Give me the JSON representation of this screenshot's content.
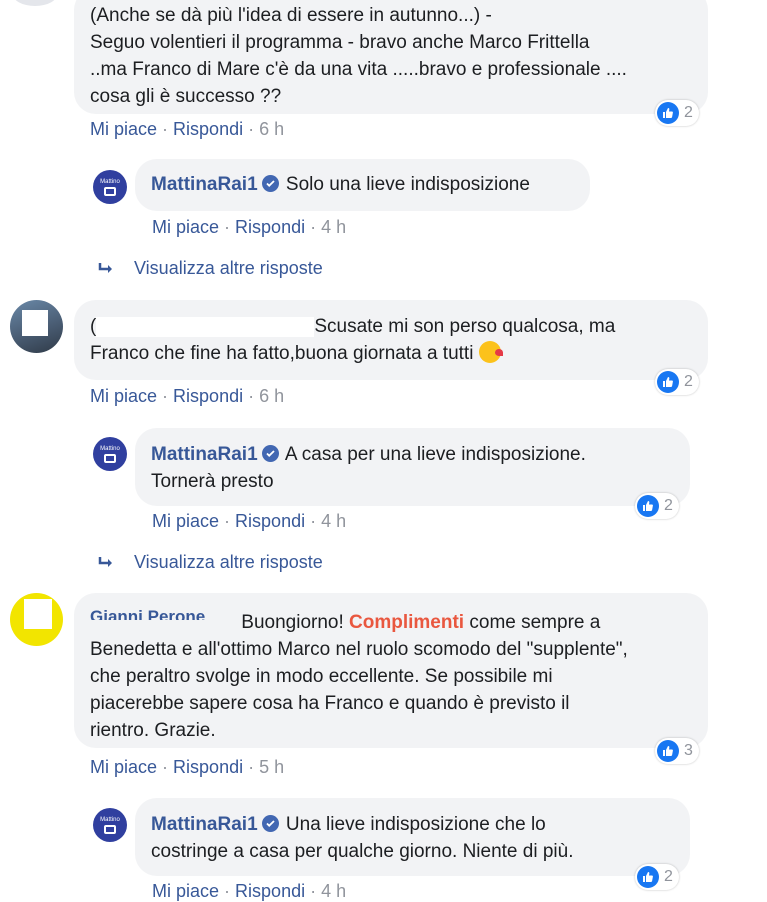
{
  "labels": {
    "like": "Mi piace",
    "reply": "Rispondi",
    "more_replies": "Visualizza altre risposte"
  },
  "comments": [
    {
      "lines": [
        "(Anche se dà più l'idea di essere in autunno...) -",
        "Seguo volentieri il programma - bravo anche Marco Frittella",
        "..ma Franco di Mare c'è da una vita .....bravo e professionale ....",
        "cosa gli è successo ??"
      ],
      "time": "6 h",
      "reactions": "2",
      "reply": {
        "author": "MattinaRai1",
        "text": "Solo una lieve indisposizione",
        "time": "4 h"
      }
    },
    {
      "lines": [
        "Scusate mi son perso qualcosa, ma",
        "Franco che fine ha fatto,buona giornata a tutti"
      ],
      "author_fragment": "(",
      "time": "6 h",
      "reactions": "2",
      "reply": {
        "author": "MattinaRai1",
        "line1": "A casa per una lieve indisposizione.",
        "line2": "Tornerà presto",
        "time": "4 h",
        "reactions": "2"
      }
    },
    {
      "author_partial": "Gianni Perone",
      "lead": "Buongiorno!",
      "highlight": "Complimenti",
      "tail": "come sempre a",
      "lines": [
        "Benedetta e all'ottimo Marco nel ruolo scomodo del \"supplente\",",
        "che peraltro svolge in modo eccellente. Se possibile mi",
        "piacerebbe sapere cosa ha Franco e quando è previsto il",
        "rientro. Grazie."
      ],
      "time": "5 h",
      "reactions": "3",
      "reply": {
        "author": "MattinaRai1",
        "line1": "Una lieve indisposizione che lo",
        "line2": "costringe a casa per qualche giorno. Niente di più.",
        "time": "4 h",
        "reactions": "2"
      }
    }
  ],
  "avatar_label": "Mattino"
}
